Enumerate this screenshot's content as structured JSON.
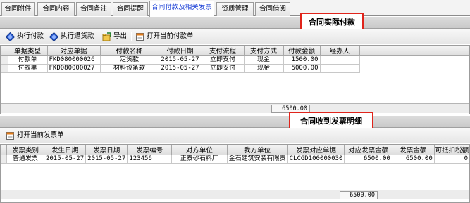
{
  "tabs": [
    {
      "label": "合同附件"
    },
    {
      "label": "合同内容"
    },
    {
      "label": "合同备注"
    },
    {
      "label": "合同提醒"
    },
    {
      "label": "合同付款及相关发票"
    },
    {
      "label": "资质管理"
    },
    {
      "label": "合同借阅"
    }
  ],
  "active_tab": "合同付款及相关发票",
  "payment_section": {
    "title": "合同实际付款",
    "toolbar": {
      "execute_payment": "执行付款",
      "execute_refund": "执行退货款",
      "export": "导出",
      "open_current": "打开当前付款单"
    },
    "columns": [
      "单据类型",
      "对应单据",
      "付款名称",
      "付款日期",
      "支付流程",
      "支付方式",
      "付款金额",
      "经办人"
    ],
    "rows": [
      [
        "付款单",
        "FKD080000026",
        "定货款",
        "2015-05-27",
        "立即支付",
        "现金",
        "1500.00",
        ""
      ],
      [
        "付款单",
        "FKD080000027",
        "材料设备款",
        "2015-05-27",
        "立即支付",
        "现金",
        "5000.00",
        ""
      ]
    ],
    "total": "6500.00"
  },
  "invoice_section": {
    "title": "合同收到发票明细",
    "toolbar": {
      "open_current": "打开当前发票单"
    },
    "columns": [
      "发票类别",
      "发生日期",
      "发票日期",
      "发票编号",
      "对方单位",
      "我方单位",
      "发票对应单据",
      "对应发票金额",
      "发票金额",
      "可抵扣税额"
    ],
    "rows": [
      [
        "普通发票",
        "2015-05-27",
        "2015-05-27",
        "123456",
        "正泰砂石料厂",
        "金石建筑安装有限责",
        "CLCGD100000030",
        "6500.00",
        "6500.00",
        "0"
      ]
    ],
    "total": "6500.00"
  },
  "colors": {
    "active_tab_text": "#1a3fd6",
    "highlight_border": "#e0241b"
  },
  "icons": {
    "execute_payment": "blue-diamond-icon",
    "execute_refund": "blue-diamond-icon",
    "export": "export-folder-icon",
    "open_current_payment": "open-document-icon",
    "open_current_invoice": "open-document-icon"
  }
}
